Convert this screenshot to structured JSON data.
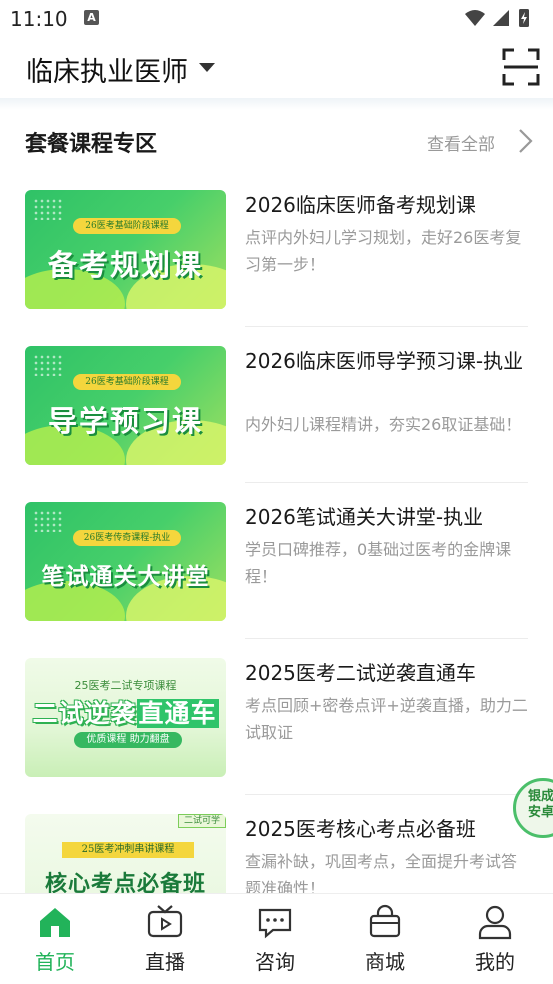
{
  "status_bar": {
    "time": "11:10",
    "notification_badge": "A"
  },
  "header": {
    "exam_type": "临床执业医师",
    "scan_icon": "scan-icon"
  },
  "section": {
    "title": "套餐课程专区",
    "view_all": "查看全部"
  },
  "courses": [
    {
      "name": "2026临床医师备考规划课",
      "desc": "点评内外妇儿学习规划，走好26医考复习第一步！",
      "thumb_tag": "26医考基础阶段课程",
      "thumb_title": "备考规划课"
    },
    {
      "name": "2026临床医师导学预习课-执业",
      "desc": "内外妇儿课程精讲，夯实26取证基础！",
      "thumb_tag": "26医考基础阶段课程",
      "thumb_title": "导学预习课"
    },
    {
      "name": "2026笔试通关大讲堂-执业",
      "desc": "学员口碑推荐，0基础过医考的金牌课程！",
      "thumb_tag": "26医考传奇课程-执业",
      "thumb_title": "笔试通关大讲堂"
    },
    {
      "name": "2025医考二试逆袭直通车",
      "desc": "考点回顾+密卷点评+逆袭直播，助力二试取证",
      "thumb_tag": "25医考二试专项课程",
      "thumb_title_plain": "二试逆袭",
      "thumb_title_highlight": "直通车",
      "thumb_sub": "优质课程 助力翻盘"
    },
    {
      "name": "2025医考核心考点必备班",
      "desc": "查漏补缺，巩固考点，全面提升考试答题准确性！",
      "thumb_corner": "二试可学",
      "thumb_tag": "25医考冲刺串讲课程",
      "thumb_title": "核心考点必备班"
    }
  ],
  "float_badge": {
    "text": "银成 安卓"
  },
  "tabs": [
    {
      "label": "首页",
      "icon": "home-icon",
      "active": true
    },
    {
      "label": "直播",
      "icon": "tv-icon",
      "active": false
    },
    {
      "label": "咨询",
      "icon": "chat-icon",
      "active": false
    },
    {
      "label": "商城",
      "icon": "shopping-bag-icon",
      "active": false
    },
    {
      "label": "我的",
      "icon": "user-icon",
      "active": false
    }
  ],
  "colors": {
    "accent": "#22b35a",
    "text": "#1a1a1a",
    "muted": "#9a9a9a"
  }
}
